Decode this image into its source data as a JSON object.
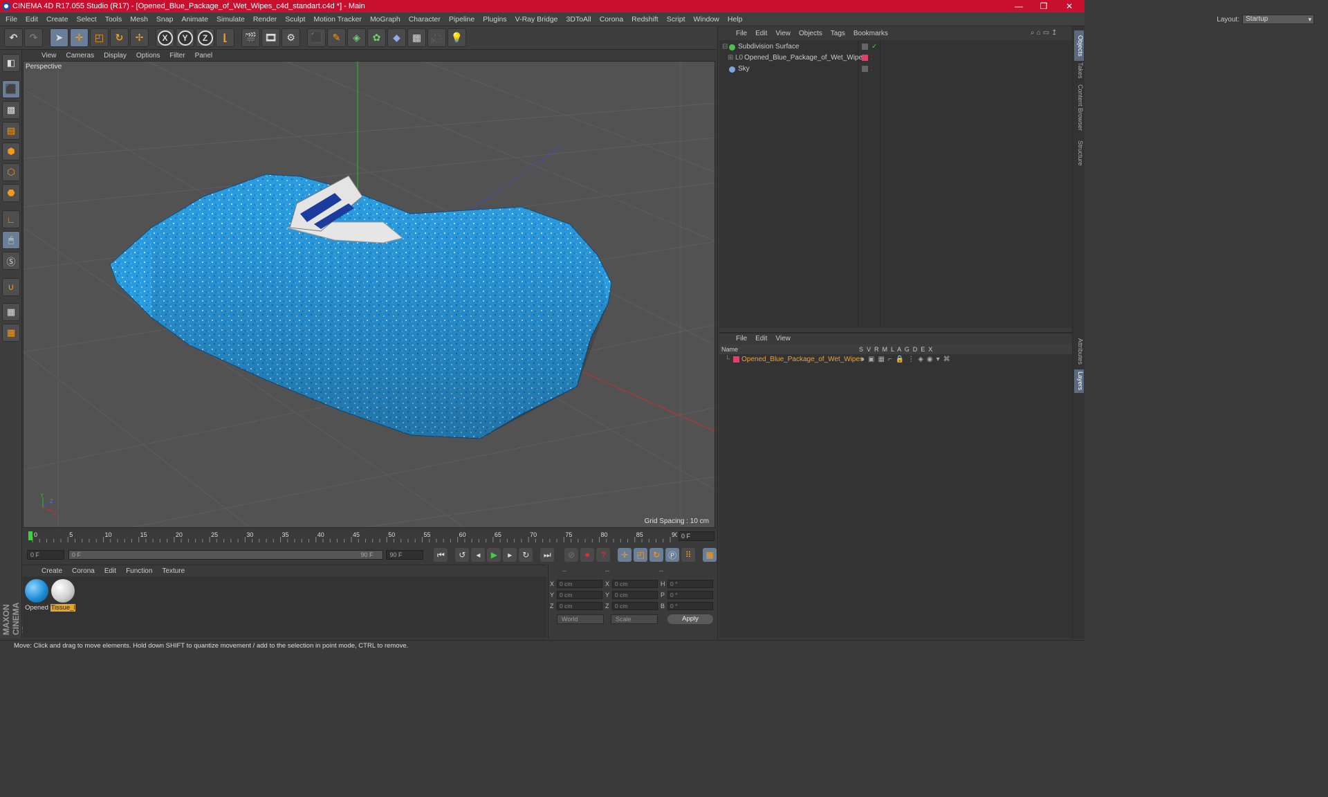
{
  "window": {
    "title": "CINEMA 4D R17.055 Studio (R17) - [Opened_Blue_Package_of_Wet_Wipes_c4d_standart.c4d *] - Main",
    "minimize": "—",
    "maximize": "❐",
    "close": "✕"
  },
  "menubar": [
    "File",
    "Edit",
    "Create",
    "Select",
    "Tools",
    "Mesh",
    "Snap",
    "Animate",
    "Simulate",
    "Render",
    "Sculpt",
    "Motion Tracker",
    "MoGraph",
    "Character",
    "Pipeline",
    "Plugins",
    "V-Ray Bridge",
    "3DToAll",
    "Corona",
    "Redshift",
    "Script",
    "Window",
    "Help"
  ],
  "layout": {
    "label": "Layout:",
    "value": "Startup"
  },
  "toolbar": {
    "x": "X",
    "y": "Y",
    "z": "Z"
  },
  "viewport": {
    "menu": [
      "View",
      "Cameras",
      "Display",
      "Options",
      "Filter",
      "Panel"
    ],
    "label": "Perspective",
    "grid_spacing": "Grid Spacing : 10 cm"
  },
  "timeline": {
    "ticks": [
      "0",
      "5",
      "10",
      "15",
      "20",
      "25",
      "30",
      "35",
      "40",
      "45",
      "50",
      "55",
      "60",
      "65",
      "70",
      "75",
      "80",
      "85",
      "90"
    ],
    "current_frame": "0 F",
    "start": "0 F",
    "range_start": "0 F",
    "range_end": "90 F",
    "end": "90 F"
  },
  "materials": {
    "menu": [
      "Create",
      "Corona",
      "Edit",
      "Function",
      "Texture"
    ],
    "items": [
      {
        "label": "Opened",
        "color": "#1e8fd6"
      },
      {
        "label": "Tissue_l",
        "color": "#d8d8d8"
      }
    ]
  },
  "coords": {
    "header": [
      "--",
      "--",
      "--"
    ],
    "rows": [
      {
        "a": "X",
        "av": "0 cm",
        "b": "X",
        "bv": "0 cm",
        "c": "H",
        "cv": "0 °"
      },
      {
        "a": "Y",
        "av": "0 cm",
        "b": "Y",
        "bv": "0 cm",
        "c": "P",
        "cv": "0 °"
      },
      {
        "a": "Z",
        "av": "0 cm",
        "b": "Z",
        "bv": "0 cm",
        "c": "B",
        "cv": "0 °"
      }
    ],
    "world": "World",
    "scale": "Scale",
    "apply": "Apply"
  },
  "objects": {
    "menu": [
      "File",
      "Edit",
      "View",
      "Objects",
      "Tags",
      "Bookmarks"
    ],
    "items": [
      {
        "name": "Subdivision Surface"
      },
      {
        "name": "Opened_Blue_Package_of_Wet_Wipes"
      },
      {
        "name": "Sky"
      }
    ]
  },
  "layers": {
    "menu": [
      "File",
      "Edit",
      "View"
    ],
    "header": {
      "name": "Name",
      "flags": "S  V  R  M  L  A  G  D  E  X"
    },
    "items": [
      {
        "name": "Opened_Blue_Package_of_Wet_Wipes",
        "color": "#e8a33a"
      }
    ]
  },
  "sidetabs": [
    "Objects",
    "Takes",
    "Content Browser",
    "Structure",
    "Attributes",
    "Layers"
  ],
  "status": "Move: Click and drag to move elements. Hold down SHIFT to quantize movement / add to the selection in point mode, CTRL to remove.",
  "maxon": "MAXON CINEMA 4D",
  "axis": {
    "y": "Y",
    "z": "Z",
    "x": "X"
  }
}
